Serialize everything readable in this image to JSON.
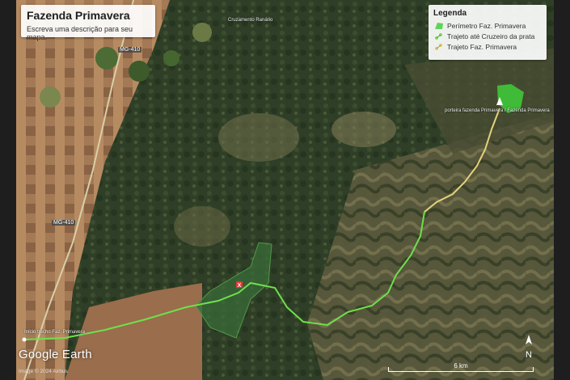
{
  "map": {
    "title": "Fazenda Primavera",
    "description": "Escreva uma descrição para seu mapa.",
    "legend": {
      "heading": "Legenda",
      "items": [
        {
          "label": "Perímetro Faz. Primavera",
          "icon": "polygon-icon",
          "color": "#5fd35a"
        },
        {
          "label": "Trajeto até Cruzeiro da prata",
          "icon": "path-icon",
          "color": "#7be05a"
        },
        {
          "label": "Trajeto Faz. Primavera",
          "icon": "path-icon",
          "color": "#d9c86a"
        }
      ]
    },
    "roads": [
      "MG-410",
      "MG-410"
    ],
    "place_labels": {
      "start": "Início trecho Faz. Primavera",
      "end": "porteira fazenda Primavera / Fazenda Primavera",
      "top": "Cruzamento Ranário",
      "marker": "X"
    },
    "brand": "Google Earth",
    "copyright": "Image © 2024 Airbus",
    "scale_label": "6 km",
    "north_label": "N",
    "colors": {
      "farmland": "#a47a56",
      "forest": "#2d3d26",
      "route_green": "#6fe04c",
      "route_yellow": "#e6d27a",
      "perimeter": "#3fcf3a"
    }
  }
}
